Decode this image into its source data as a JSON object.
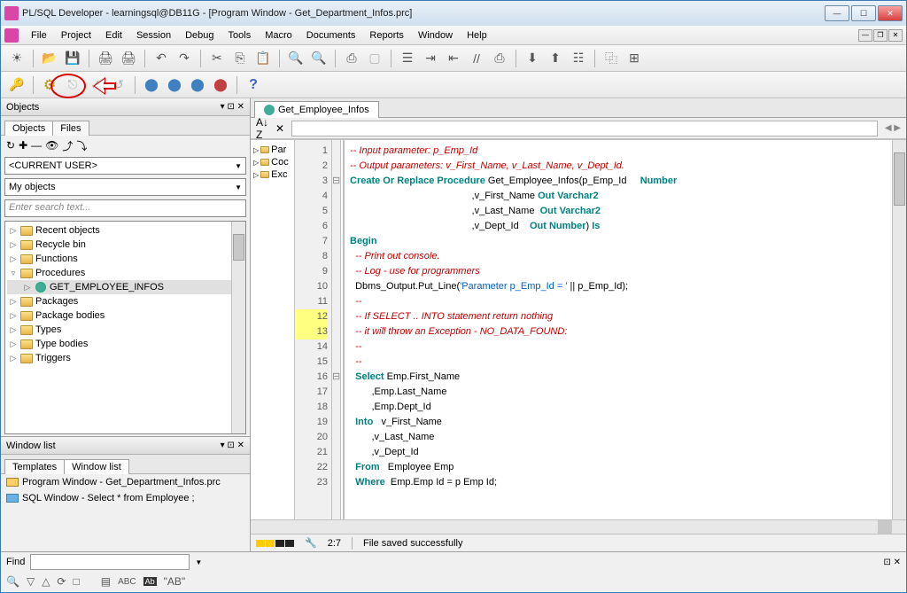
{
  "window": {
    "title": "PL/SQL Developer - learningsql@DB11G - [Program Window - Get_Department_Infos.prc]"
  },
  "menu": {
    "items": [
      "File",
      "Project",
      "Edit",
      "Session",
      "Debug",
      "Tools",
      "Macro",
      "Documents",
      "Reports",
      "Window",
      "Help"
    ]
  },
  "objects_panel": {
    "title": "Objects",
    "tabs": [
      "Objects",
      "Files"
    ],
    "active_tab": 0,
    "user_combo": "<CURRENT USER>",
    "filter_combo": "My objects",
    "search_placeholder": "Enter search text...",
    "tree": [
      {
        "label": "Recent objects",
        "type": "folder",
        "exp": "▷"
      },
      {
        "label": "Recycle bin",
        "type": "folder",
        "exp": "▷"
      },
      {
        "label": "Functions",
        "type": "folder",
        "exp": "▷"
      },
      {
        "label": "Procedures",
        "type": "folder",
        "exp": "▿",
        "expanded": true
      },
      {
        "label": "GET_EMPLOYEE_INFOS",
        "type": "proc",
        "indent": 1,
        "exp": "▷",
        "selected": true
      },
      {
        "label": "Packages",
        "type": "folder",
        "exp": "▷"
      },
      {
        "label": "Package bodies",
        "type": "folder",
        "exp": "▷"
      },
      {
        "label": "Types",
        "type": "folder",
        "exp": "▷"
      },
      {
        "label": "Type bodies",
        "type": "folder",
        "exp": "▷"
      },
      {
        "label": "Triggers",
        "type": "folder",
        "exp": "▷"
      }
    ]
  },
  "window_list": {
    "title": "Window list",
    "tabs": [
      "Templates",
      "Window list"
    ],
    "active_tab": 1,
    "items": [
      {
        "label": "Program Window - Get_Department_Infos.prc",
        "kind": "prog"
      },
      {
        "label": "SQL Window - Select * from Employee ;",
        "kind": "sql"
      }
    ]
  },
  "editor": {
    "tab_label": "Get_Employee_Infos",
    "nav_items": [
      "Par",
      "Coc",
      "Exc"
    ],
    "cursor_pos": "2:7",
    "status": "File saved successfully",
    "lines": [
      {
        "n": 1,
        "segs": [
          [
            "-- Input parameter: p_Emp_Id",
            "c-comment"
          ]
        ]
      },
      {
        "n": 2,
        "segs": [
          [
            "-- Output parameters: v_First_Name, v_Last_Name, v_Dept_Id.",
            "c-comment"
          ]
        ]
      },
      {
        "n": 3,
        "fold": "⊟",
        "segs": [
          [
            "Create Or Replace Procedure",
            "c-kw"
          ],
          [
            " Get_Employee_Infos(p_Emp_Id     ",
            ""
          ],
          [
            "Number",
            "c-kw"
          ]
        ]
      },
      {
        "n": 4,
        "segs": [
          [
            "                                             ,v_First_Name ",
            ""
          ],
          [
            "Out Varchar2",
            "c-kw"
          ]
        ]
      },
      {
        "n": 5,
        "segs": [
          [
            "                                             ,v_Last_Name  ",
            ""
          ],
          [
            "Out Varchar2",
            "c-kw"
          ]
        ]
      },
      {
        "n": 6,
        "segs": [
          [
            "                                             ,v_Dept_Id    ",
            ""
          ],
          [
            "Out Number",
            "c-kw"
          ],
          [
            ") ",
            ""
          ],
          [
            "Is",
            "c-kw"
          ]
        ]
      },
      {
        "n": 7,
        "segs": [
          [
            "Begin",
            "c-kw"
          ]
        ]
      },
      {
        "n": 8,
        "segs": [
          [
            "  ",
            ""
          ],
          [
            "-- Print out console.",
            "c-comment"
          ]
        ]
      },
      {
        "n": 9,
        "segs": [
          [
            "  ",
            ""
          ],
          [
            "-- Log - use for programmers",
            "c-comment"
          ]
        ]
      },
      {
        "n": 10,
        "segs": [
          [
            "  Dbms_Output.Put_Line(",
            ""
          ],
          [
            "'Parameter p_Emp_Id = '",
            "c-str"
          ],
          [
            " || p_Emp_Id);",
            ""
          ]
        ]
      },
      {
        "n": 11,
        "segs": [
          [
            "  ",
            ""
          ],
          [
            "--",
            "c-comment"
          ]
        ]
      },
      {
        "n": 12,
        "hl": true,
        "segs": [
          [
            "  ",
            ""
          ],
          [
            "-- If SELECT .. INTO statement return nothing",
            "c-comment"
          ]
        ]
      },
      {
        "n": 13,
        "hl": true,
        "segs": [
          [
            "  ",
            ""
          ],
          [
            "-- it will throw an Exception - NO_DATA_FOUND:",
            "c-comment"
          ]
        ]
      },
      {
        "n": 14,
        "segs": [
          [
            "  ",
            ""
          ],
          [
            "--",
            "c-comment"
          ]
        ]
      },
      {
        "n": 15,
        "segs": [
          [
            "  ",
            ""
          ],
          [
            "--",
            "c-comment"
          ]
        ]
      },
      {
        "n": 16,
        "fold": "⊟",
        "segs": [
          [
            "  ",
            ""
          ],
          [
            "Select",
            "c-kw"
          ],
          [
            " Emp.First_Name",
            ""
          ]
        ]
      },
      {
        "n": 17,
        "segs": [
          [
            "        ,Emp.Last_Name",
            ""
          ]
        ]
      },
      {
        "n": 18,
        "segs": [
          [
            "        ,Emp.Dept_Id",
            ""
          ]
        ]
      },
      {
        "n": 19,
        "segs": [
          [
            "  ",
            ""
          ],
          [
            "Into",
            "c-kw"
          ],
          [
            "   v_First_Name",
            ""
          ]
        ]
      },
      {
        "n": 20,
        "segs": [
          [
            "        ,v_Last_Name",
            ""
          ]
        ]
      },
      {
        "n": 21,
        "segs": [
          [
            "        ,v_Dept_Id",
            ""
          ]
        ]
      },
      {
        "n": 22,
        "segs": [
          [
            "  ",
            ""
          ],
          [
            "From",
            "c-kw"
          ],
          [
            "   Employee Emp",
            ""
          ]
        ]
      },
      {
        "n": 23,
        "segs": [
          [
            "  ",
            ""
          ],
          [
            "Where",
            "c-kw"
          ],
          [
            "  Emp.Emp Id = p Emp Id;",
            ""
          ]
        ]
      }
    ]
  },
  "find": {
    "label": "Find",
    "ab_label": "\"AB\""
  }
}
